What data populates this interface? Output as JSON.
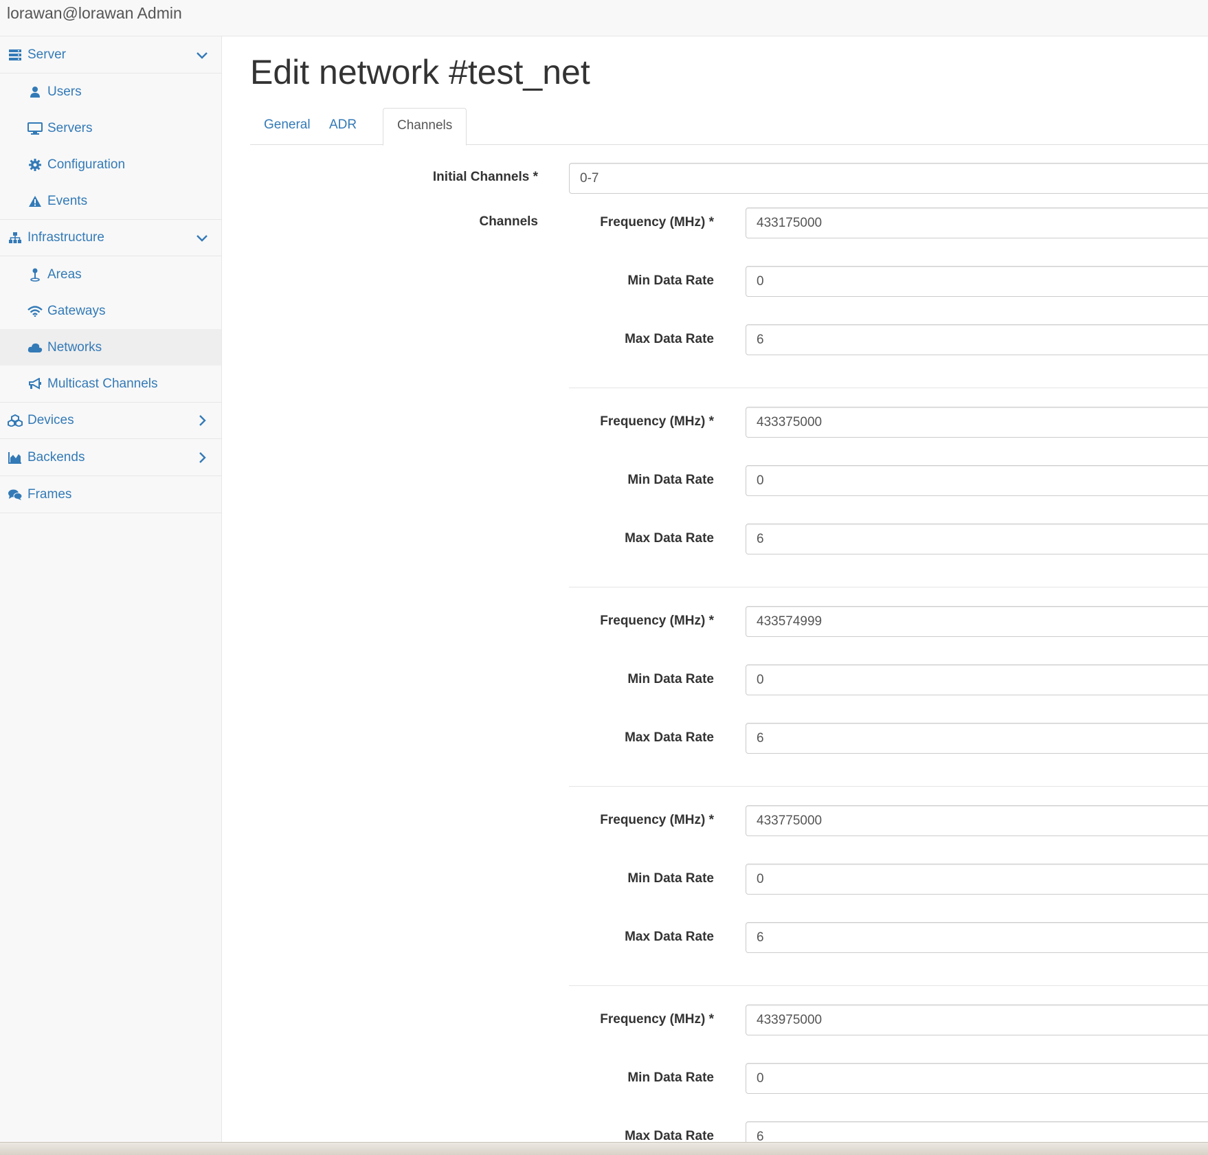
{
  "header": {
    "title": "lorawan@lorawan Admin"
  },
  "sidebar": {
    "server": {
      "label": "Server",
      "icon": "server-icon",
      "chevron": "chevron-down-icon"
    },
    "users": {
      "label": "Users",
      "icon": "user-icon"
    },
    "servers": {
      "label": "Servers",
      "icon": "monitor-icon"
    },
    "configuration": {
      "label": "Configuration",
      "icon": "gear-icon"
    },
    "events": {
      "label": "Events",
      "icon": "warning-icon"
    },
    "infrastructure": {
      "label": "Infrastructure",
      "icon": "sitemap-icon",
      "chevron": "chevron-down-icon"
    },
    "areas": {
      "label": "Areas",
      "icon": "location-pin-icon"
    },
    "gateways": {
      "label": "Gateways",
      "icon": "wifi-icon"
    },
    "networks": {
      "label": "Networks",
      "icon": "cloud-icon",
      "active": true
    },
    "multicast": {
      "label": "Multicast Channels",
      "icon": "megaphone-icon"
    },
    "devices": {
      "label": "Devices",
      "icon": "cubes-icon",
      "chevron": "chevron-right-icon"
    },
    "backends": {
      "label": "Backends",
      "icon": "area-chart-icon",
      "chevron": "chevron-right-icon"
    },
    "frames": {
      "label": "Frames",
      "icon": "comments-icon"
    }
  },
  "page": {
    "title": "Edit network #test_net"
  },
  "tabs": [
    {
      "label": "General",
      "active": false
    },
    {
      "label": "ADR",
      "active": false
    },
    {
      "label": "Channels",
      "active": true
    }
  ],
  "form": {
    "initial_channels_label": "Initial Channels *",
    "initial_channels_value": "0-7",
    "channels_label": "Channels",
    "frequency_label": "Frequency (MHz) *",
    "min_rate_label": "Min Data Rate",
    "max_rate_label": "Max Data Rate",
    "channels": [
      {
        "frequency": "433175000",
        "min_rate": "0",
        "max_rate": "6"
      },
      {
        "frequency": "433375000",
        "min_rate": "0",
        "max_rate": "6"
      },
      {
        "frequency": "433574999",
        "min_rate": "0",
        "max_rate": "6"
      },
      {
        "frequency": "433775000",
        "min_rate": "0",
        "max_rate": "6"
      },
      {
        "frequency": "433975000",
        "min_rate": "0",
        "max_rate": "6"
      }
    ]
  },
  "colors": {
    "link": "#337ab7",
    "text": "#333333",
    "border": "#dddddd"
  }
}
